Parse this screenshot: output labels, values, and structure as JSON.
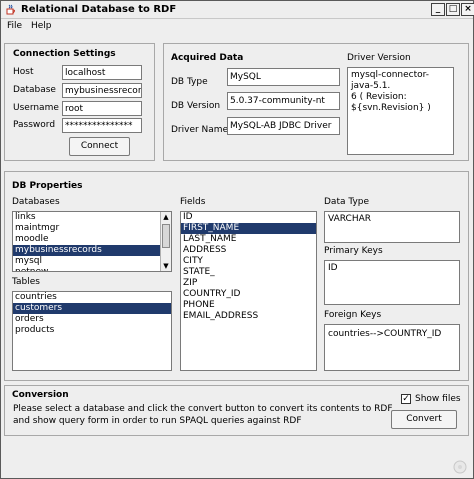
{
  "window": {
    "title": "Relational Database to RDF"
  },
  "menu": {
    "file": "File",
    "help": "Help"
  },
  "connection": {
    "title": "Connection Settings",
    "host_label": "Host",
    "host_value": "localhost",
    "database_label": "Database",
    "database_value": "mybusinessrecords",
    "username_label": "Username",
    "username_value": "root",
    "password_label": "Password",
    "password_value": "***************",
    "connect_label": "Connect"
  },
  "acquired": {
    "title": "Acquired Data",
    "dbtype_label": "DB Type",
    "dbtype_value": "MySQL",
    "dbversion_label": "DB Version",
    "dbversion_value": "5.0.37-community-nt",
    "driver_label": "Driver Name",
    "driver_value": "MySQL-AB JDBC Driver",
    "driver_version_label": "Driver Version",
    "driver_version_line1": "mysql-connector-java-5.1.",
    "driver_version_line2": "6 ( Revision:",
    "driver_version_line3": "${svn.Revision} )"
  },
  "dbprops": {
    "title": "DB Properties",
    "databases_label": "Databases",
    "databases": [
      "links",
      "maintmgr",
      "moodle",
      "mybusinessrecords",
      "mysql",
      "netnew"
    ],
    "tables_label": "Tables",
    "tables": [
      "countries",
      "customers",
      "orders",
      "products"
    ],
    "fields_label": "Fields",
    "fields": [
      "ID",
      "FIRST_NAME",
      "LAST_NAME",
      "ADDRESS",
      "CITY",
      "STATE_",
      "ZIP",
      "COUNTRY_ID",
      "PHONE",
      "EMAIL_ADDRESS"
    ],
    "datatype_label": "Data Type",
    "datatype_value": "VARCHAR",
    "primary_label": "Primary Keys",
    "primary_value": "ID",
    "foreign_label": "Foreign Keys",
    "foreign_value": "countries-->COUNTRY_ID"
  },
  "conversion": {
    "title": "Conversion",
    "line1": "Please select a database and click the convert button to convert its contents to RDF",
    "line2": "and show query form in order to run SPAQL queries against RDF",
    "showfiles_label": "Show files",
    "convert_label": "Convert"
  },
  "colors": {
    "selection": "#203a6c",
    "window_bg": "#eeeeee"
  }
}
